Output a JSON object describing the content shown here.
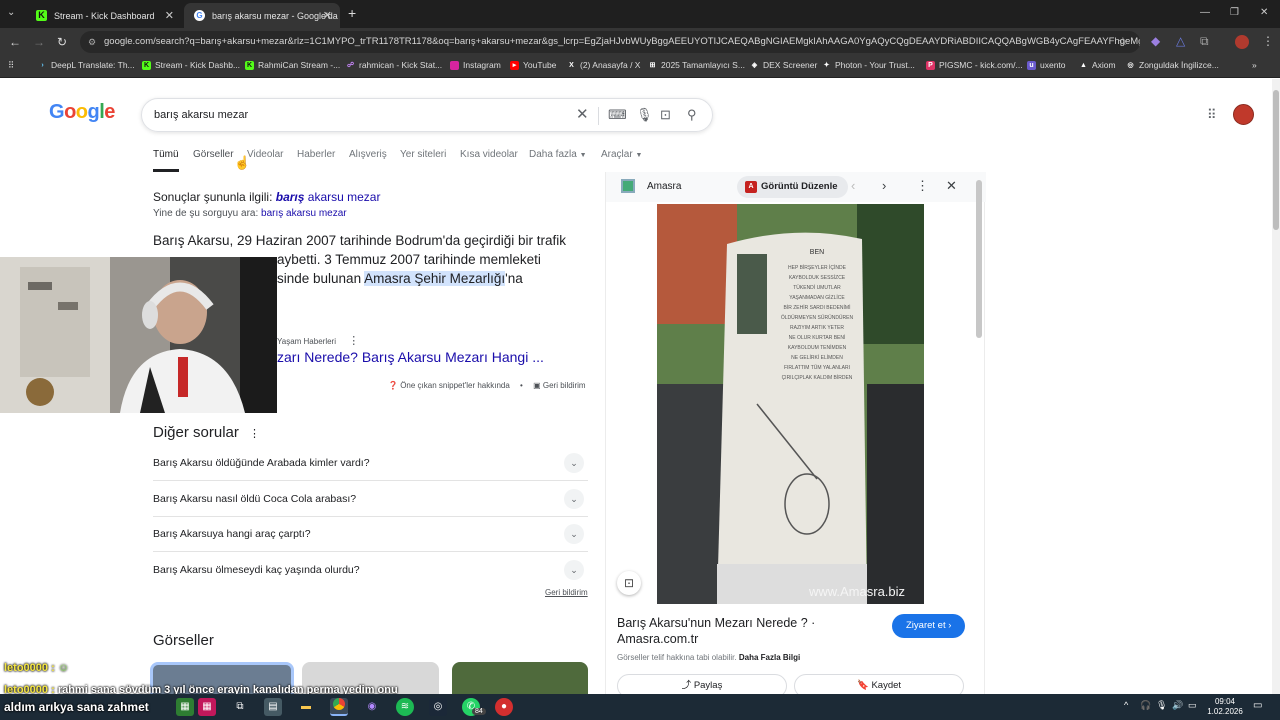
{
  "browser": {
    "tabs": [
      {
        "title": "Stream - Kick Dashboard",
        "active": false
      },
      {
        "title": "barış akarsu mezar - Google'da",
        "active": true
      }
    ],
    "url": "google.com/search?q=barış+akarsu+mezar&rlz=1C1MYPO_trTR1178TR1178&oq=barış+akarsu+mezar&gs_lcrp=EgZjaHJvbWUyBggAEEUYOTIJCAEQABgNGIAEMgkIAhAAGA0YgAQyCQgDEAAYDRiABDIICAQQABgWGB4yCAgFEAAYFhgeMggIBh...",
    "bookmarks": [
      "DeepL Translate: Th...",
      "Stream - Kick Dashb...",
      "RahmiCan Stream -...",
      "rahmican - Kick Stat...",
      "Instagram",
      "YouTube",
      "(2) Anasayfa / X",
      "2025 Tamamlayıcı S...",
      "DEX Screener",
      "Photon - Your Trust...",
      "PIGSMC - kick.com/...",
      "uxento",
      "Axiom",
      "Zonguldak İngilizce..."
    ]
  },
  "google": {
    "logo": "Google",
    "query": "barış akarsu mezar",
    "tabs": [
      "Tümü",
      "Görseller",
      "Videolar",
      "Haberler",
      "Alışveriş",
      "Yer siteleri",
      "Kısa videolar",
      "Daha fazla",
      "Araçlar"
    ]
  },
  "results": {
    "related_prefix": "Sonuçlar şununla ilgili:",
    "related_bold": "barış",
    "related_rest": " akarsu mezar",
    "instead_prefix": "Yine de şu sorguyu ara:",
    "instead_query": "barış akarsu mezar",
    "snippet_line1": "Barış Akarsu, 29 Haziran 2007 tarihinde Bodrum'da geçirdiği bir trafik",
    "snippet_line2": "aybetti. 3 Temmuz 2007 tarihinde memleketi",
    "snippet_line3_pre": "sinde bulunan ",
    "snippet_highlight": "Amasra Şehir Mezarlığı",
    "snippet_line3_post": "'na",
    "source_name": "Yaşam Haberleri",
    "source_title": "zarı Nerede? Barış Akarsu Mezarı Hangi ...",
    "snippet_about": "Öne çıkan snippet'ler hakkında",
    "feedback": "Geri bildirim"
  },
  "paa": {
    "title": "Diğer sorular",
    "questions": [
      "Barış Akarsu öldüğünde Arabada kimler vardı?",
      "Barış Akarsu nasıl öldü Coca Cola arabası?",
      "Barış Akarsuya hangi araç çarptı?",
      "Barış Akarsu ölmeseydi kaç yaşında olurdu?"
    ],
    "feedback": "Geri bildirim"
  },
  "images_title": "Görseller",
  "panel": {
    "site": "Amasra",
    "edit_button": "Görüntü Düzenle",
    "watermark": "www.Amasra.biz",
    "title_line1": "Barış Akarsu'nun Mezarı Nerede ? ·",
    "title_line2": "Amasra.com.tr",
    "copyright_pre": "Görseller telif hakkına tabi olabilir.",
    "copyright_link": "Daha Fazla Bilgi",
    "visit_button": "Ziyaret et",
    "share_button": "Paylaş",
    "save_button": "Kaydet"
  },
  "chat": [
    {
      "user": "leto0000 :",
      "message": ""
    },
    {
      "user": "leto0000 :",
      "message": "rahmi sana sövdüm 3 yıl önce erayin kanalıdan perma yedim onu"
    },
    {
      "user": "",
      "message": "aldım arıkya sana zahmet"
    }
  ],
  "taskbar": {
    "time": "09:04",
    "date": "1.02.2026",
    "whatsapp_badge": "84"
  },
  "colors": {
    "google_blue": "#4285f4",
    "google_red": "#ea4335",
    "google_yellow": "#fbbc05",
    "google_green": "#34a853",
    "link": "#1a0dab",
    "visit": "#1a73e8",
    "chat_yellow": "#f5e642",
    "chat_green": "#9be86a"
  }
}
